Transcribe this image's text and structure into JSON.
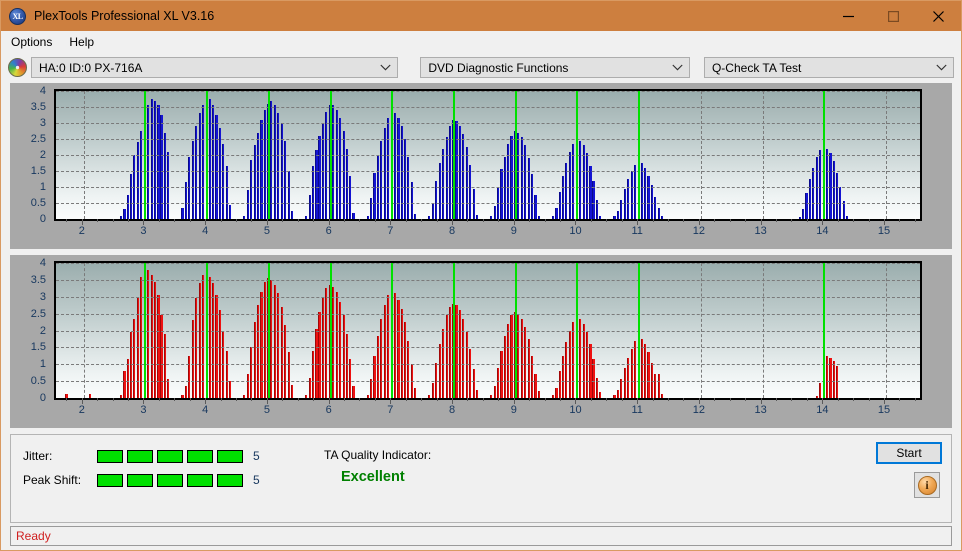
{
  "window": {
    "title": "PlexTools Professional XL V3.16",
    "app_icon": "XL",
    "controls": {
      "minimize": "minimize-icon",
      "maximize": "maximize-icon",
      "close": "close-icon"
    },
    "accent_color": "#cd7f3f"
  },
  "menubar": {
    "items": [
      {
        "label": "Options"
      },
      {
        "label": "Help"
      }
    ]
  },
  "toolbar": {
    "drive_icon": "disc-icon",
    "drive_select": {
      "value": "HA:0 ID:0  PX-716A"
    },
    "function_select": {
      "value": "DVD Diagnostic Functions"
    },
    "test_select": {
      "value": "Q-Check TA Test"
    }
  },
  "results": {
    "jitter_label": "Jitter:",
    "jitter_value": "5",
    "jitter_blocks": 5,
    "peak_shift_label": "Peak Shift:",
    "peak_shift_value": "5",
    "peak_shift_blocks": 5,
    "tqi_label": "TA Quality Indicator:",
    "tqi_value": "Excellent",
    "tqi_color": "#008000",
    "start_label": "Start",
    "info_icon": "info-icon",
    "block_color": "#00e000"
  },
  "statusbar": {
    "text": "Ready",
    "color": "#d02020"
  },
  "chart_data": [
    {
      "id": "ta-jitter-chart",
      "type": "bar",
      "title": "",
      "xlabel": "",
      "ylabel": "",
      "series_name": "Jitter",
      "color": "#1414d2",
      "marker_color": "#00e000",
      "grid": true,
      "xlim": [
        1.55,
        15.55
      ],
      "ylim": [
        0,
        4
      ],
      "yticks": [
        0,
        0.5,
        1,
        1.5,
        2,
        2.5,
        3,
        3.5,
        4
      ],
      "ytick_labels": [
        "0",
        "0.5",
        "1",
        "1.5",
        "2",
        "2.5",
        "3",
        "3.5",
        "4"
      ],
      "xticks": [
        2,
        3,
        4,
        5,
        6,
        7,
        8,
        9,
        10,
        11,
        12,
        13,
        14,
        15
      ],
      "xtick_labels": [
        "2",
        "3",
        "4",
        "5",
        "6",
        "7",
        "8",
        "9",
        "10",
        "11",
        "12",
        "13",
        "14",
        "15"
      ],
      "markers": [
        3,
        4,
        5,
        6,
        7,
        8,
        9,
        10,
        11,
        14
      ],
      "bar_width": 0.035,
      "x": [
        2.6,
        2.66,
        2.71,
        2.77,
        2.82,
        2.88,
        2.93,
        2.99,
        3.04,
        3.1,
        3.15,
        3.21,
        3.26,
        3.32,
        3.37,
        3.6,
        3.66,
        3.71,
        3.77,
        3.82,
        3.88,
        3.93,
        3.99,
        4.04,
        4.1,
        4.15,
        4.21,
        4.26,
        4.32,
        4.37,
        4.6,
        4.66,
        4.71,
        4.77,
        4.82,
        4.88,
        4.93,
        4.99,
        5.04,
        5.1,
        5.15,
        5.21,
        5.26,
        5.32,
        5.37,
        5.6,
        5.66,
        5.71,
        5.77,
        5.82,
        5.88,
        5.93,
        5.99,
        6.04,
        6.1,
        6.15,
        6.21,
        6.26,
        6.32,
        6.37,
        6.6,
        6.66,
        6.71,
        6.77,
        6.82,
        6.88,
        6.93,
        6.99,
        7.04,
        7.1,
        7.15,
        7.21,
        7.26,
        7.32,
        7.37,
        7.6,
        7.66,
        7.71,
        7.77,
        7.82,
        7.88,
        7.93,
        7.99,
        8.04,
        8.1,
        8.15,
        8.21,
        8.26,
        8.32,
        8.37,
        8.6,
        8.66,
        8.71,
        8.77,
        8.82,
        8.88,
        8.93,
        8.99,
        9.04,
        9.1,
        9.15,
        9.21,
        9.26,
        9.32,
        9.37,
        9.6,
        9.66,
        9.71,
        9.77,
        9.82,
        9.88,
        9.93,
        9.99,
        10.04,
        10.1,
        10.15,
        10.21,
        10.26,
        10.32,
        10.37,
        10.6,
        10.66,
        10.71,
        10.77,
        10.82,
        10.88,
        10.93,
        10.99,
        11.04,
        11.1,
        11.15,
        11.21,
        11.26,
        11.32,
        11.37,
        13.6,
        13.66,
        13.71,
        13.77,
        13.82,
        13.88,
        13.93,
        13.99,
        14.04,
        14.1,
        14.15,
        14.21,
        14.26,
        14.32,
        14.37
      ],
      "values": [
        0.1,
        0.3,
        0.75,
        1.4,
        2.0,
        2.4,
        2.75,
        3.15,
        3.55,
        3.75,
        3.7,
        3.55,
        3.25,
        2.7,
        2.1,
        0.35,
        1.15,
        1.95,
        2.45,
        2.9,
        3.3,
        3.55,
        3.8,
        3.75,
        3.55,
        3.25,
        2.85,
        2.35,
        1.65,
        0.45,
        0.1,
        0.9,
        1.85,
        2.3,
        2.7,
        3.1,
        3.4,
        3.6,
        3.7,
        3.55,
        3.3,
        3.0,
        2.45,
        1.5,
        0.25,
        0.1,
        0.75,
        1.65,
        2.15,
        2.6,
        3.0,
        3.35,
        3.55,
        3.55,
        3.4,
        3.15,
        2.75,
        2.2,
        1.35,
        0.2,
        0.1,
        0.65,
        1.45,
        2.0,
        2.45,
        2.85,
        3.15,
        3.35,
        3.3,
        3.15,
        2.9,
        2.5,
        1.95,
        1.15,
        0.15,
        0.1,
        0.5,
        1.2,
        1.75,
        2.2,
        2.55,
        2.9,
        3.1,
        3.05,
        2.9,
        2.65,
        2.25,
        1.7,
        0.95,
        0.12,
        0.1,
        0.4,
        1.0,
        1.55,
        1.95,
        2.35,
        2.6,
        2.75,
        2.7,
        2.55,
        2.3,
        1.9,
        1.4,
        0.75,
        0.1,
        0.1,
        0.35,
        0.85,
        1.35,
        1.75,
        2.1,
        2.35,
        2.5,
        2.45,
        2.3,
        2.05,
        1.65,
        1.2,
        0.6,
        0.1,
        0.1,
        0.25,
        0.6,
        0.95,
        1.25,
        1.5,
        1.7,
        1.8,
        1.75,
        1.6,
        1.35,
        1.05,
        0.7,
        0.35,
        0.08,
        0.05,
        0.3,
        0.8,
        1.25,
        1.6,
        1.95,
        2.15,
        2.25,
        2.2,
        2.05,
        1.8,
        1.45,
        1.0,
        0.55,
        0.1
      ]
    },
    {
      "id": "ta-peak-shift-chart",
      "type": "bar",
      "title": "",
      "xlabel": "",
      "ylabel": "",
      "series_name": "Peak Shift",
      "color": "#ee1111",
      "marker_color": "#00e000",
      "grid": true,
      "xlim": [
        1.55,
        15.55
      ],
      "ylim": [
        0,
        4
      ],
      "yticks": [
        0,
        0.5,
        1,
        1.5,
        2,
        2.5,
        3,
        3.5,
        4
      ],
      "ytick_labels": [
        "0",
        "0.5",
        "1",
        "1.5",
        "2",
        "2.5",
        "3",
        "3.5",
        "4"
      ],
      "xticks": [
        2,
        3,
        4,
        5,
        6,
        7,
        8,
        9,
        10,
        11,
        12,
        13,
        14,
        15
      ],
      "xtick_labels": [
        "2",
        "3",
        "4",
        "5",
        "6",
        "7",
        "8",
        "9",
        "10",
        "11",
        "12",
        "13",
        "14",
        "15"
      ],
      "markers": [
        3,
        4,
        5,
        6,
        7,
        8,
        9,
        10,
        11,
        14
      ],
      "bar_width": 0.035,
      "x": [
        1.72,
        2.1,
        2.6,
        2.66,
        2.71,
        2.77,
        2.82,
        2.88,
        2.93,
        2.99,
        3.04,
        3.1,
        3.15,
        3.21,
        3.26,
        3.32,
        3.37,
        3.6,
        3.66,
        3.71,
        3.77,
        3.82,
        3.88,
        3.93,
        3.99,
        4.04,
        4.1,
        4.15,
        4.21,
        4.26,
        4.32,
        4.37,
        4.6,
        4.66,
        4.71,
        4.77,
        4.82,
        4.88,
        4.93,
        4.99,
        5.04,
        5.1,
        5.15,
        5.21,
        5.26,
        5.32,
        5.37,
        5.6,
        5.66,
        5.71,
        5.77,
        5.82,
        5.88,
        5.93,
        5.99,
        6.04,
        6.1,
        6.15,
        6.21,
        6.26,
        6.32,
        6.37,
        6.6,
        6.66,
        6.71,
        6.77,
        6.82,
        6.88,
        6.93,
        6.99,
        7.04,
        7.1,
        7.15,
        7.21,
        7.26,
        7.32,
        7.37,
        7.6,
        7.66,
        7.71,
        7.77,
        7.82,
        7.88,
        7.93,
        7.99,
        8.04,
        8.1,
        8.15,
        8.21,
        8.26,
        8.32,
        8.37,
        8.6,
        8.66,
        8.71,
        8.77,
        8.82,
        8.88,
        8.93,
        8.99,
        9.04,
        9.1,
        9.15,
        9.21,
        9.26,
        9.32,
        9.37,
        9.6,
        9.66,
        9.71,
        9.77,
        9.82,
        9.88,
        9.93,
        9.99,
        10.04,
        10.1,
        10.15,
        10.21,
        10.26,
        10.32,
        10.37,
        10.6,
        10.66,
        10.71,
        10.77,
        10.82,
        10.88,
        10.93,
        10.99,
        11.04,
        11.1,
        11.15,
        11.21,
        11.26,
        11.32,
        11.37,
        13.88,
        13.93,
        13.99,
        14.04,
        14.1,
        14.15,
        14.21
      ],
      "values": [
        0.12,
        0.12,
        0.1,
        0.8,
        1.15,
        1.95,
        2.35,
        2.95,
        3.6,
        3.7,
        3.8,
        3.65,
        3.45,
        3.05,
        2.45,
        1.9,
        0.55,
        0.1,
        0.35,
        1.25,
        2.3,
        2.95,
        3.4,
        3.65,
        3.75,
        3.6,
        3.4,
        3.05,
        2.6,
        2.0,
        1.4,
        0.5,
        0.1,
        0.7,
        1.5,
        2.25,
        2.75,
        3.15,
        3.45,
        3.55,
        3.5,
        3.35,
        3.1,
        2.7,
        2.15,
        1.35,
        0.4,
        0.1,
        0.6,
        1.4,
        2.05,
        2.55,
        2.95,
        3.25,
        3.35,
        3.3,
        3.15,
        2.85,
        2.45,
        1.9,
        1.15,
        0.35,
        0.1,
        0.55,
        1.25,
        1.85,
        2.35,
        2.75,
        3.05,
        3.15,
        3.1,
        2.9,
        2.65,
        2.25,
        1.7,
        1.0,
        0.3,
        0.1,
        0.45,
        1.05,
        1.6,
        2.05,
        2.45,
        2.7,
        2.8,
        2.75,
        2.6,
        2.35,
        1.95,
        1.45,
        0.85,
        0.25,
        0.1,
        0.35,
        0.9,
        1.4,
        1.85,
        2.2,
        2.45,
        2.55,
        2.5,
        2.35,
        2.1,
        1.75,
        1.25,
        0.7,
        0.2,
        0.1,
        0.3,
        0.8,
        1.25,
        1.65,
        2.0,
        2.25,
        2.4,
        2.35,
        2.2,
        1.95,
        1.6,
        1.15,
        0.6,
        0.18,
        0.1,
        0.25,
        0.55,
        0.9,
        1.2,
        1.45,
        1.7,
        1.8,
        1.75,
        1.6,
        1.35,
        1.05,
        0.7,
        0.7,
        0.12,
        0.05,
        0.45,
        0.9,
        1.25,
        1.2,
        1.1,
        0.95
      ]
    }
  ]
}
